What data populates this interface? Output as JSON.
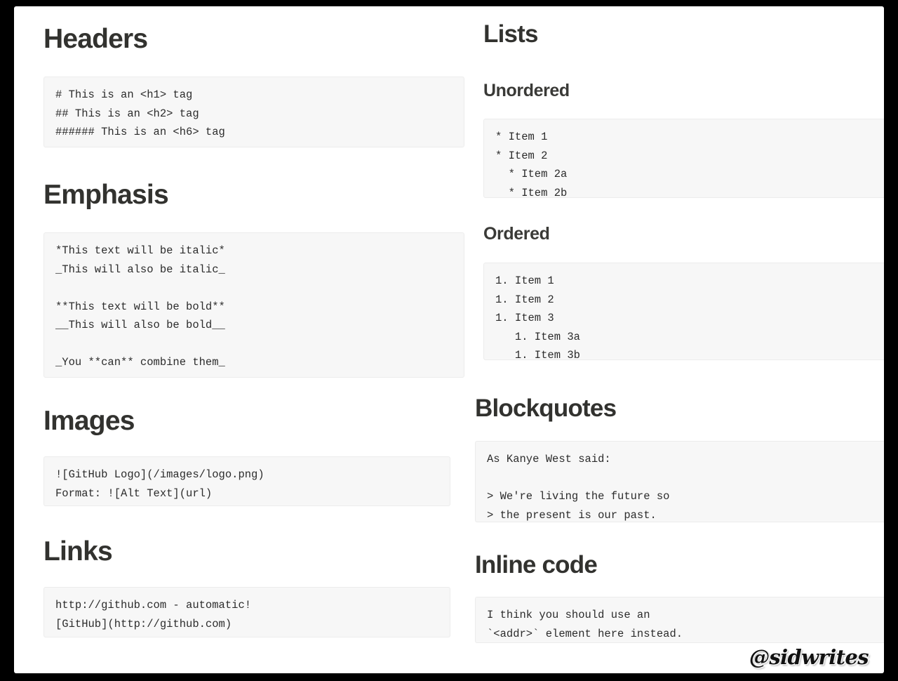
{
  "watermark": "@sidwrites",
  "colors": {
    "page_background": "#ffffff",
    "frame": "#000000",
    "heading": "#32322f",
    "code_text": "#2c2c2c",
    "code_background": "#f7f7f7",
    "code_border": "#ececec"
  },
  "left_column": {
    "headers": {
      "title": "Headers",
      "code": "# This is an <h1> tag\n## This is an <h2> tag\n###### This is an <h6> tag"
    },
    "emphasis": {
      "title": "Emphasis",
      "code": "*This text will be italic*\n_This will also be italic_\n\n**This text will be bold**\n__This will also be bold__\n\n_You **can** combine them_"
    },
    "images": {
      "title": "Images",
      "code": "![GitHub Logo](/images/logo.png)\nFormat: ![Alt Text](url)"
    },
    "links": {
      "title": "Links",
      "code": "http://github.com - automatic!\n[GitHub](http://github.com)"
    }
  },
  "right_column": {
    "lists": {
      "title": "Lists",
      "unordered": {
        "title": "Unordered",
        "code": "* Item 1\n* Item 2\n  * Item 2a\n  * Item 2b"
      },
      "ordered": {
        "title": "Ordered",
        "code": "1. Item 1\n1. Item 2\n1. Item 3\n   1. Item 3a\n   1. Item 3b"
      }
    },
    "blockquotes": {
      "title": "Blockquotes",
      "code": "As Kanye West said:\n\n> We're living the future so\n> the present is our past."
    },
    "inline_code": {
      "title": "Inline code",
      "code": "I think you should use an\n`<addr>` element here instead."
    }
  }
}
